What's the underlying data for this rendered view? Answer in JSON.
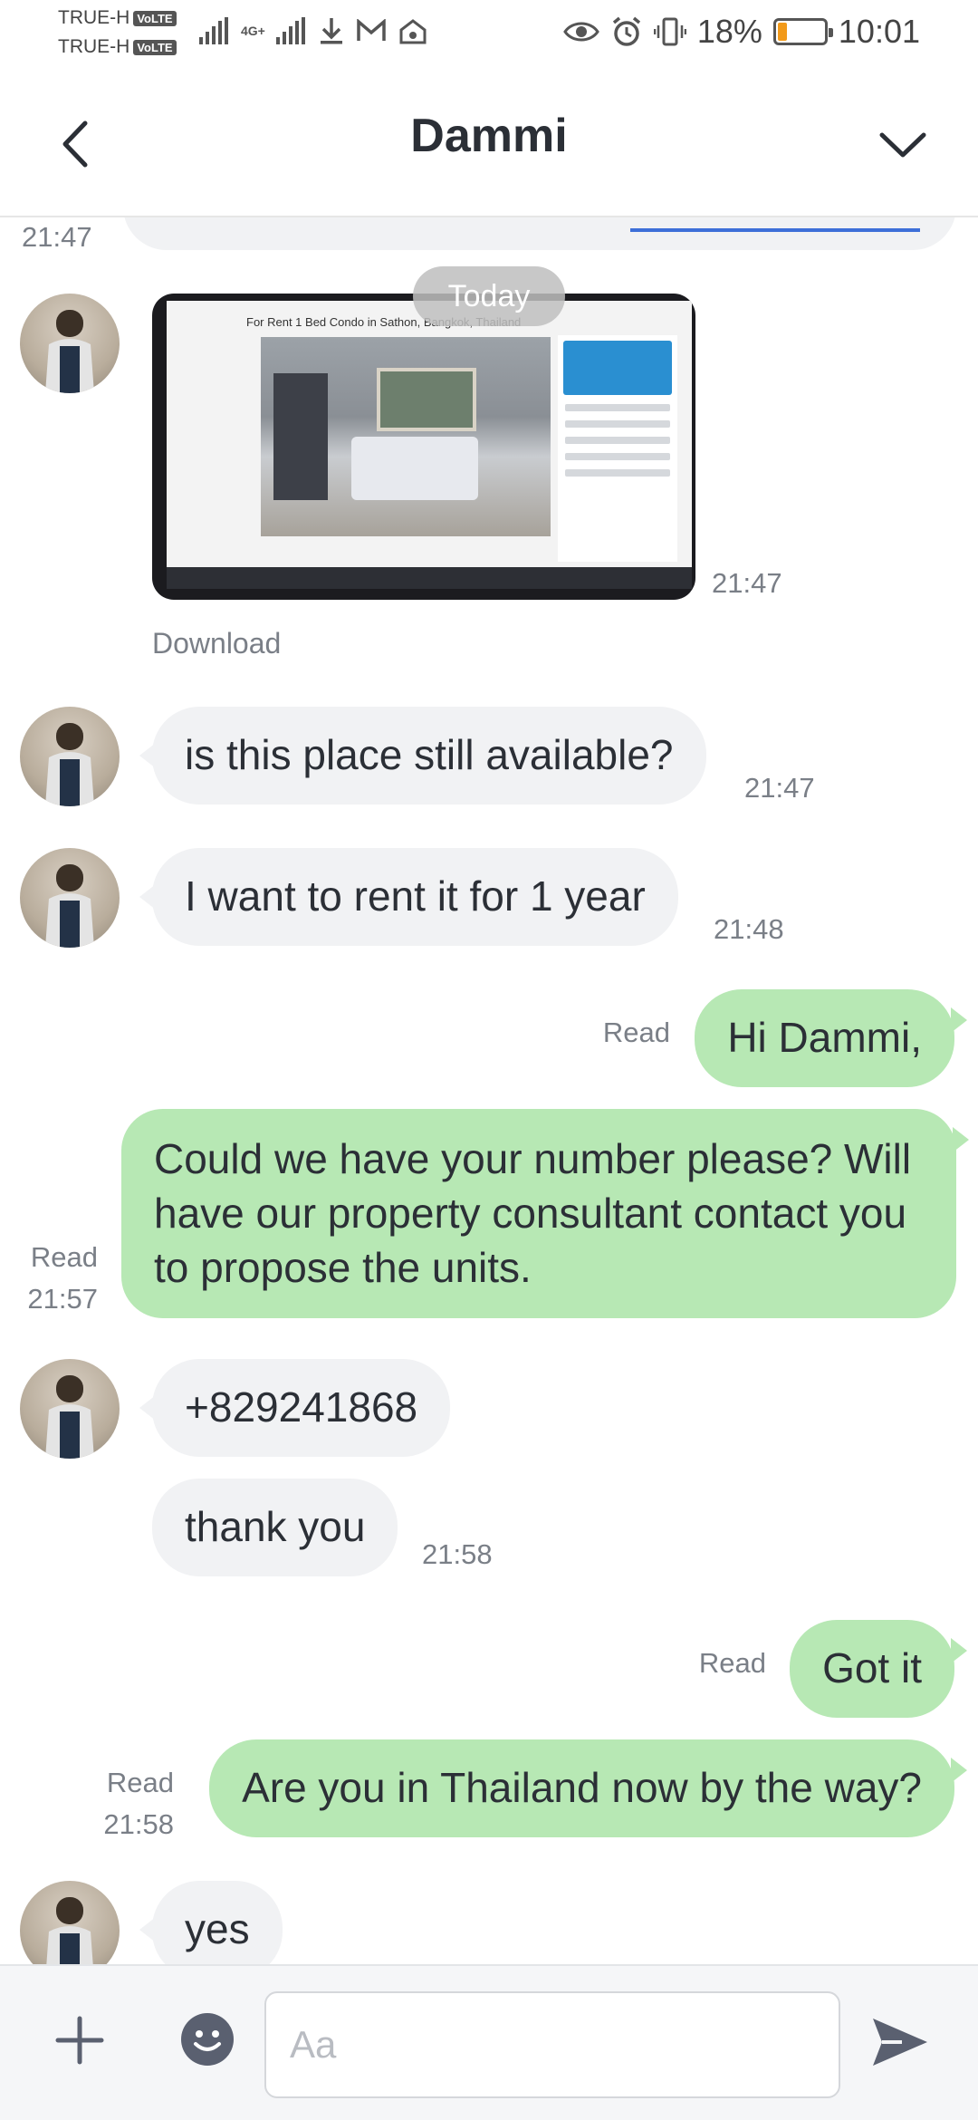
{
  "status_bar": {
    "carrier_1": "TRUE-H",
    "carrier_2": "TRUE-H",
    "volte_badge": "VoLTE",
    "network": "4G+",
    "battery_percent": "18%",
    "battery_level": 0.18,
    "battery_color": "#f29a1a",
    "time": "10:01",
    "icons": [
      "signal-icon",
      "download-icon",
      "gmail-icon",
      "hotspot-icon",
      "eye-icon",
      "alarm-icon",
      "vibrate-icon",
      "battery-icon"
    ]
  },
  "header": {
    "title": "Dammi",
    "back_icon": "chevron-left-icon",
    "menu_icon": "chevron-down-icon"
  },
  "chat": {
    "top_partial_time": "21:47",
    "date_separator": "Today",
    "image_message": {
      "photo_caption": "For Rent 1 Bed Condo in Sathon, Bangkok, Thailand",
      "time": "21:47",
      "download_label": "Download"
    },
    "messages": [
      {
        "id": "m1",
        "direction": "in",
        "text": "is this place still available?",
        "time": "21:47"
      },
      {
        "id": "m2",
        "direction": "in",
        "text": "I want to rent it for 1 year",
        "time": "21:48"
      },
      {
        "id": "m3",
        "direction": "out",
        "text": "Hi Dammi,",
        "read": "Read"
      },
      {
        "id": "m4",
        "direction": "out",
        "text": "Could we have your number please? Will have our property consultant contact you to propose the units.",
        "read": "Read",
        "time": "21:57"
      },
      {
        "id": "m5",
        "direction": "in",
        "text": "+829241868"
      },
      {
        "id": "m6",
        "direction": "in",
        "text": "thank you",
        "time": "21:58"
      },
      {
        "id": "m7",
        "direction": "out",
        "text": "Got it",
        "read": "Read"
      },
      {
        "id": "m8",
        "direction": "out",
        "text": "Are you in Thailand now by the way?",
        "read": "Read",
        "time": "21:58"
      },
      {
        "id": "m9",
        "direction": "in",
        "text": "yes"
      }
    ]
  },
  "input_bar": {
    "placeholder": "Aa",
    "value": "",
    "plus_icon": "plus-icon",
    "emoji_icon": "emoji-icon",
    "send_icon": "send-icon"
  },
  "colors": {
    "outgoing_bubble": "#b7e8b4",
    "incoming_bubble": "#f1f2f4",
    "icon_gray": "#5a6070"
  }
}
